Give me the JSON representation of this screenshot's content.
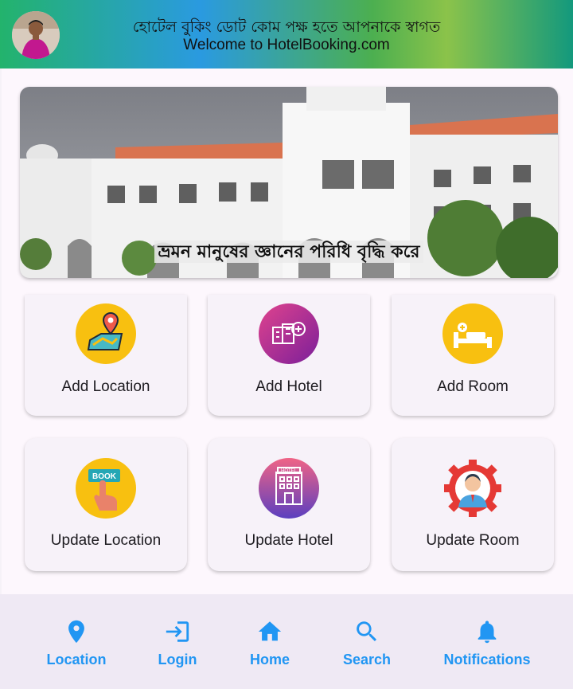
{
  "header": {
    "title_bn": "হোটেল বুকিং ডোট কোম পক্ষ  হতে আপনাকে স্বাগত",
    "title_en": "Welcome to HotelBooking.com"
  },
  "banner": {
    "caption": "ভ্রমন মানুষের জ্ঞানের পরিধি বৃদ্ধি করে"
  },
  "cards": [
    {
      "label": "Add Location",
      "icon": "map-pin-icon"
    },
    {
      "label": "Add Hotel",
      "icon": "hotel-add-icon"
    },
    {
      "label": "Add Room",
      "icon": "bed-icon"
    },
    {
      "label": "Update Location",
      "icon": "book-tap-icon"
    },
    {
      "label": "Update Hotel",
      "icon": "hotel-building-icon"
    },
    {
      "label": "Update Room",
      "icon": "gear-person-icon"
    }
  ],
  "nav": [
    {
      "label": "Location",
      "icon": "location-pin-icon"
    },
    {
      "label": "Login",
      "icon": "login-icon"
    },
    {
      "label": "Home",
      "icon": "home-icon"
    },
    {
      "label": "Search",
      "icon": "search-icon"
    },
    {
      "label": "Notifications",
      "icon": "bell-icon"
    }
  ],
  "colors": {
    "accent": "#2196f3",
    "card_bg": "#f7f2f9",
    "nav_bg": "#efe9f4"
  }
}
